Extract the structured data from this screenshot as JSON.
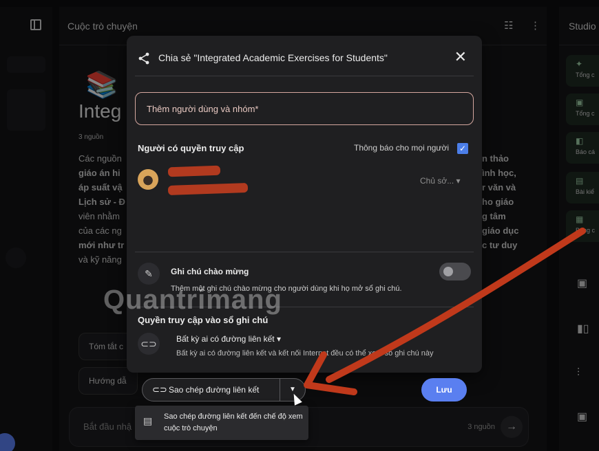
{
  "header": {
    "center_title": "Cuộc trò chuyện",
    "studio_title": "Studio"
  },
  "notebook": {
    "title": "Integ",
    "sources_count": "3 nguồn",
    "summary_left": [
      "Các nguồn",
      "giáo án hi",
      "áp suất vậ",
      "Lịch sử - Đ",
      "viên nhằm",
      "của các ng",
      "mới như tr",
      "và kỹ năng"
    ],
    "summary_right": [
      "n thảo",
      "ình học,",
      "r văn và",
      "ho giáo",
      "g tâm",
      "giáo dục",
      "c tư duy"
    ],
    "chips": [
      "Tóm tắt c",
      "Hướng dẫ"
    ]
  },
  "chat": {
    "placeholder": "Bắt đầu nhậ",
    "source_count": "3 nguồn"
  },
  "studio": {
    "items": [
      {
        "icon": "audio-overview-icon",
        "label": "Tổng c"
      },
      {
        "icon": "video-overview-icon",
        "label": "Tổng c"
      },
      {
        "icon": "report-icon",
        "label": "Báo cá"
      },
      {
        "icon": "quiz-icon",
        "label": "Bài kiể"
      },
      {
        "icon": "table-icon",
        "label": "Bảng c"
      }
    ]
  },
  "dialog": {
    "title": "Chia sẻ \"Integrated Academic Exercises for Students\"",
    "add_people_placeholder": "Thêm người dùng và nhóm*",
    "access_heading": "Người có quyền truy cập",
    "notify_label": "Thông báo cho mọi người",
    "role_label": "Chủ sở...",
    "welcome_title": "Ghi chú chào mừng",
    "welcome_desc": "Thêm một ghi chú chào mừng cho người dùng khi họ mở sổ ghi chú.",
    "notebook_access_heading": "Quyền truy cập vào sổ ghi chú",
    "access_option": "Bất kỳ ai có đường liên kết",
    "access_desc": "Bất kỳ ai có đường liên kết và kết nối Internet đều có thể xem sổ ghi chú này",
    "copy_link_label": "Sao chép đường liên kết",
    "save_label": "Lưu",
    "menu_item_label": "Sao chép đường liên kết đến chế độ xem cuộc trò chuyện"
  },
  "watermark": "uantrimang",
  "colors": {
    "accent": "#5a7ff0",
    "annotation": "#c0391b",
    "input_border": "#d6a8a0"
  }
}
